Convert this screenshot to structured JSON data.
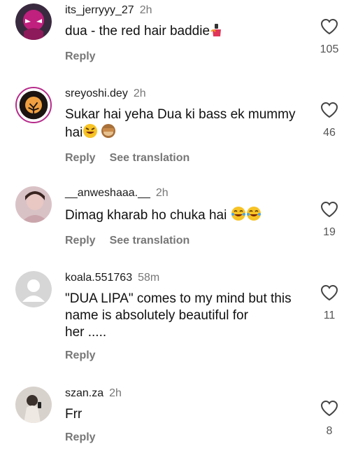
{
  "comments": [
    {
      "username": "its_jerryyy_27",
      "time": "2h",
      "text": "dua - the red hair baddie",
      "reply_label": "Reply",
      "likes": "105",
      "emoji": [
        "nail-polish"
      ]
    },
    {
      "username": "sreyoshi.dey",
      "time": "2h",
      "text_line1": "Sukar hai yeha Dua ki bass ek mummy",
      "text_line2": "hai",
      "reply_label": "Reply",
      "translate_label": "See translation",
      "likes": "46",
      "emoji": [
        "rolling-laughing",
        "see-no-evil-monkey"
      ]
    },
    {
      "username": "__anweshaaa.__",
      "time": "2h",
      "text": "Dimag kharab ho chuka hai",
      "reply_label": "Reply",
      "translate_label": "See translation",
      "likes": "19",
      "emoji": [
        "tears-of-joy",
        "tears-of-joy"
      ]
    },
    {
      "username": "koala.551763",
      "time": "58m",
      "text_line1": "\"DUA LIPA\" comes to my mind but this",
      "text_line2": "name is absolutely beautiful for",
      "text_line3": "her .....",
      "reply_label": "Reply",
      "likes": "11"
    },
    {
      "username": "szan.za",
      "time": "2h",
      "text": "Frr",
      "reply_label": "Reply",
      "likes": "8"
    }
  ],
  "colors": {
    "username": "#1a1a1a",
    "secondary": "#777777",
    "text": "#111111",
    "story_ring": "#b62a8a"
  }
}
